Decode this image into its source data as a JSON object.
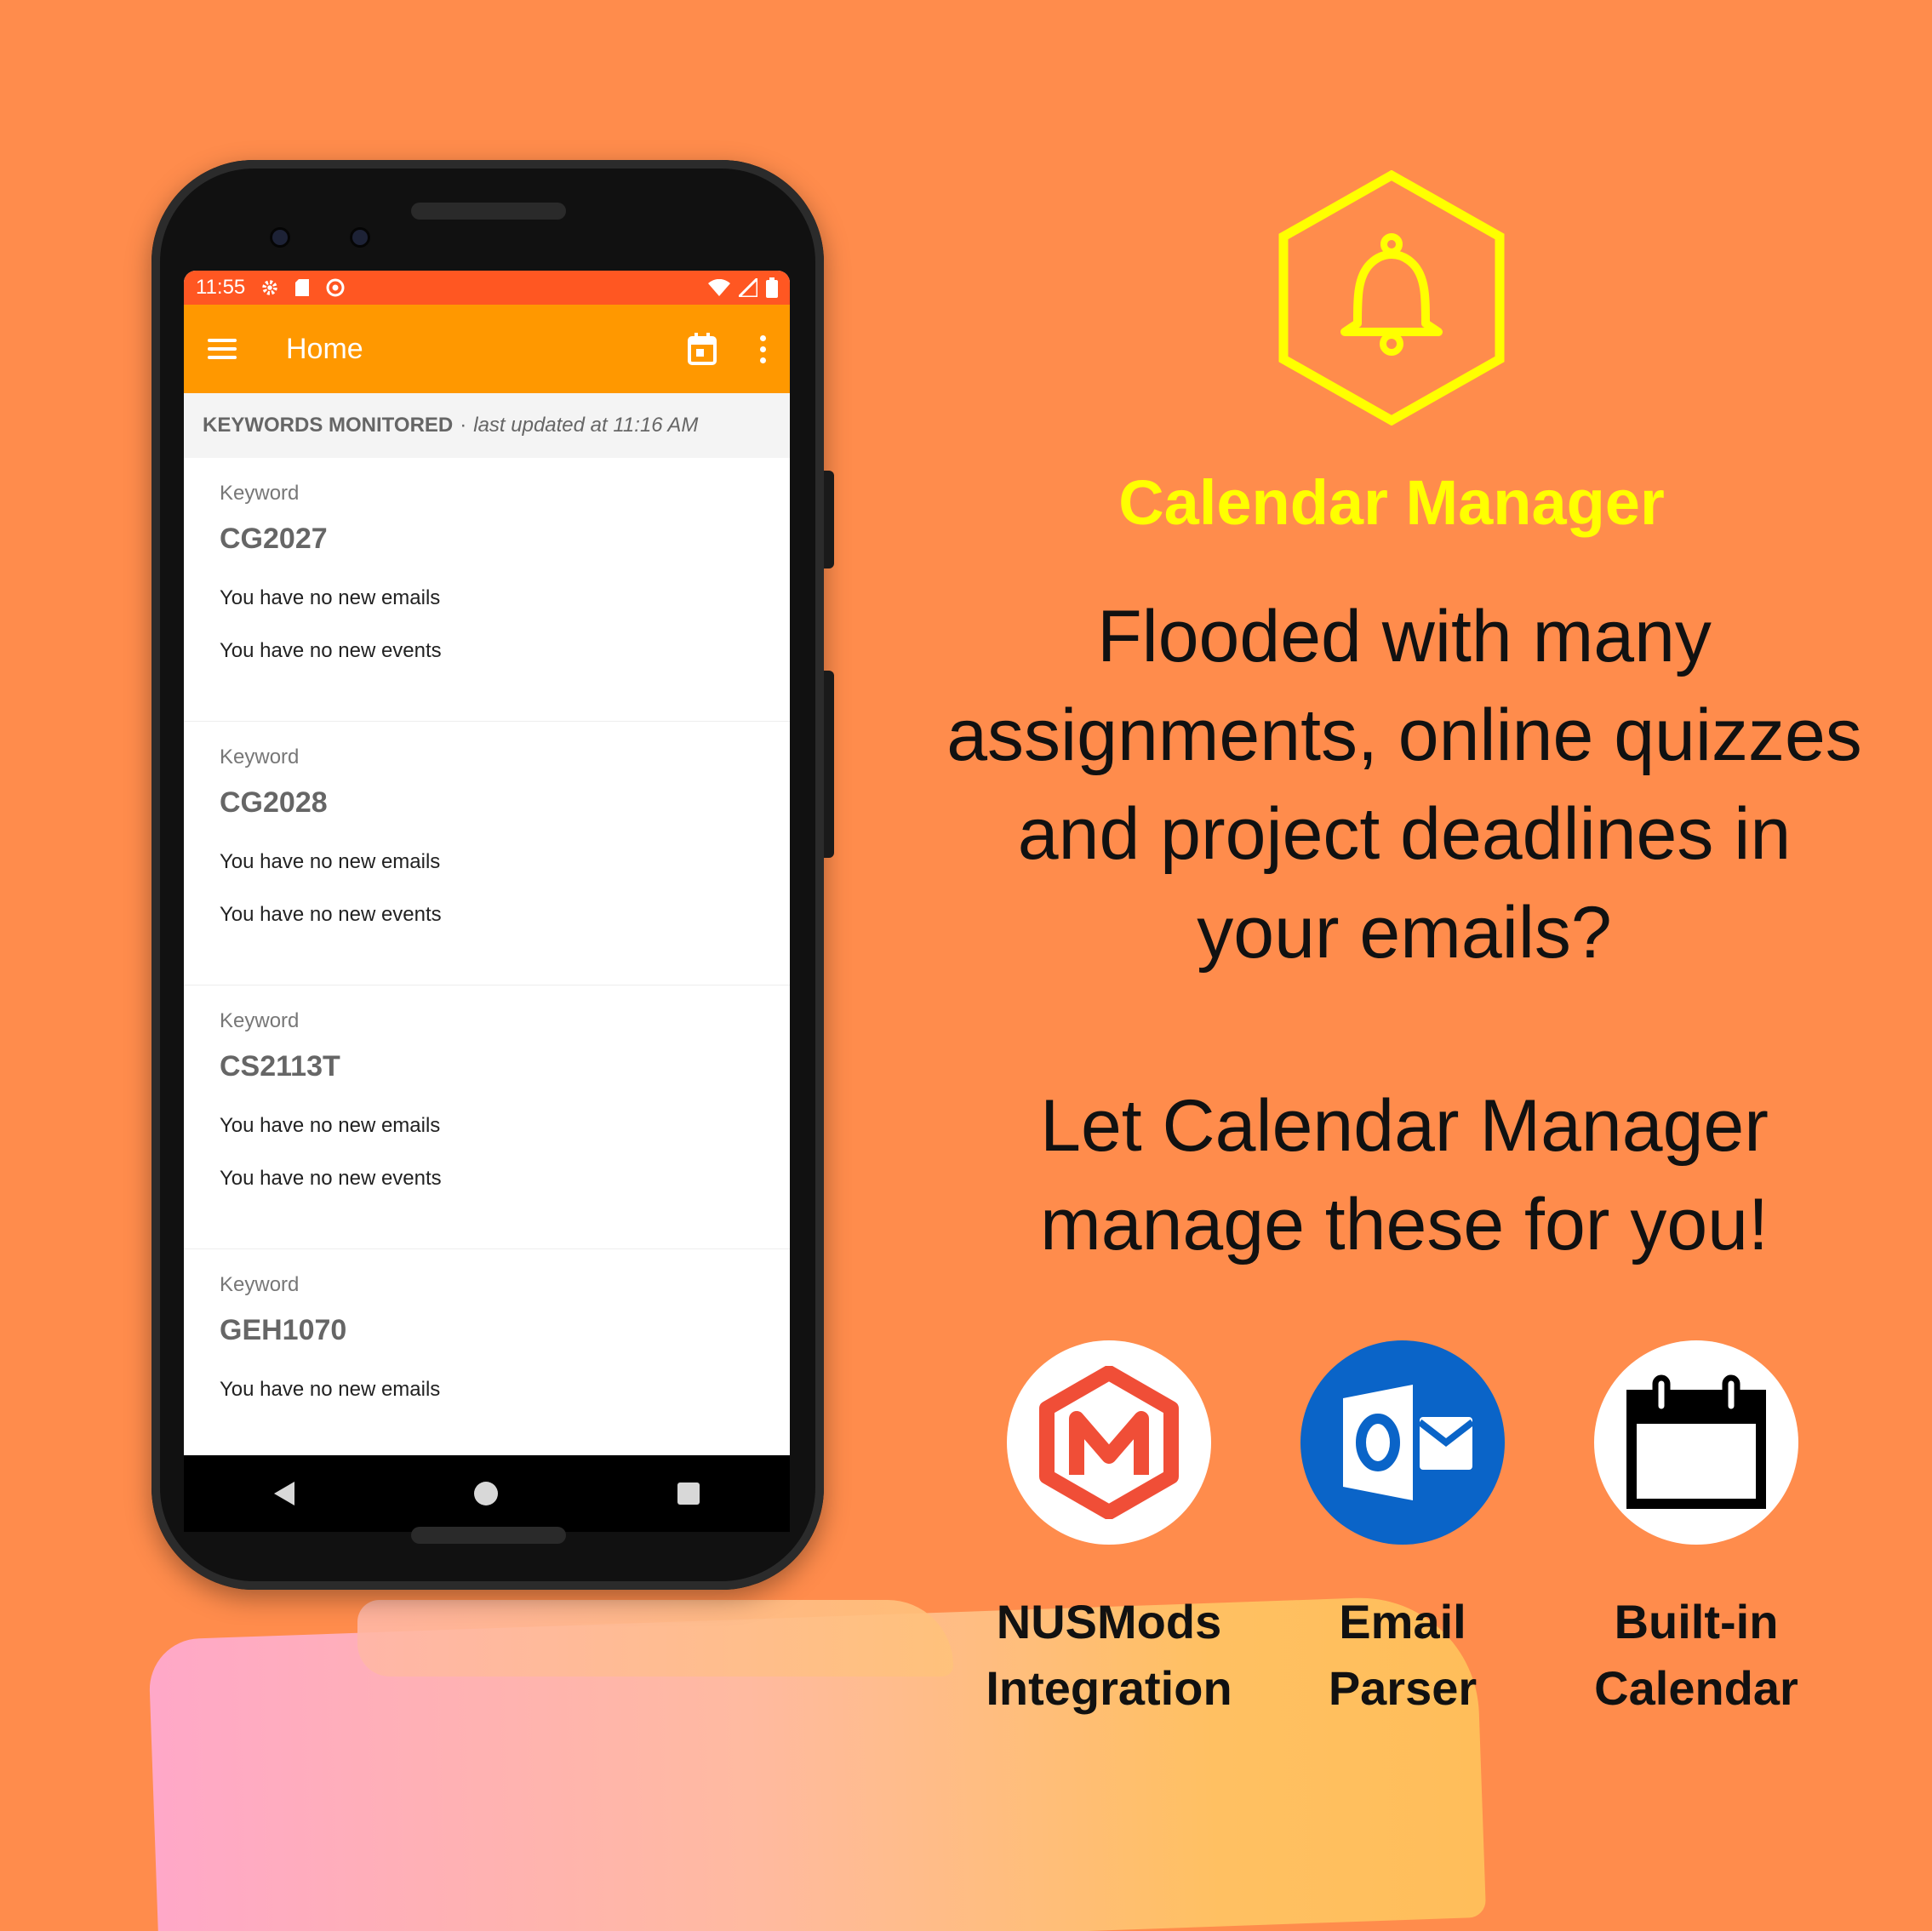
{
  "colors": {
    "background": "#FF8C4C",
    "statusbar": "#FF5722",
    "appbar": "#FF9800",
    "brand": "#FFFF00",
    "outlook_blue": "#0A64C8",
    "nusmods_red": "#F04E37"
  },
  "phone": {
    "statusbar": {
      "time": "11:55",
      "icons_left": [
        "gear-icon",
        "sd-card-icon",
        "sync-icon"
      ],
      "icons_right": [
        "wifi-icon",
        "signal-icon",
        "battery-icon"
      ]
    },
    "appbar": {
      "title": "Home",
      "menu_icon": "hamburger-icon",
      "calendar_icon": "calendar-icon",
      "overflow_icon": "more-vert-icon"
    },
    "section": {
      "header": "KEYWORDS MONITORED",
      "separator": "·",
      "updated": "last updated at 11:16 AM"
    },
    "keywords": [
      {
        "label": "Keyword",
        "value": "CG2027",
        "emails": "You have no new emails",
        "events": "You have no new events"
      },
      {
        "label": "Keyword",
        "value": "CG2028",
        "emails": "You have no new emails",
        "events": "You have no new events"
      },
      {
        "label": "Keyword",
        "value": "CS2113T",
        "emails": "You have no new emails",
        "events": "You have no new events"
      },
      {
        "label": "Keyword",
        "value": "GEH1070",
        "emails": "You have no new emails",
        "events": ""
      }
    ]
  },
  "brand": {
    "icon": "bell-icon",
    "name": "Calendar Manager"
  },
  "pitch": [
    "Flooded with many",
    "assignments, online quizzes",
    "and project deadlines in",
    "your emails?"
  ],
  "cta": [
    "Let Calendar Manager",
    "manage these for you!"
  ],
  "features": [
    {
      "icon": "nusmods-logo-icon",
      "line1": "NUSMods",
      "line2": "Integration"
    },
    {
      "icon": "outlook-icon",
      "line1": "Email",
      "line2": "Parser"
    },
    {
      "icon": "calendar-icon",
      "line1": "Built-in",
      "line2": "Calendar"
    }
  ]
}
